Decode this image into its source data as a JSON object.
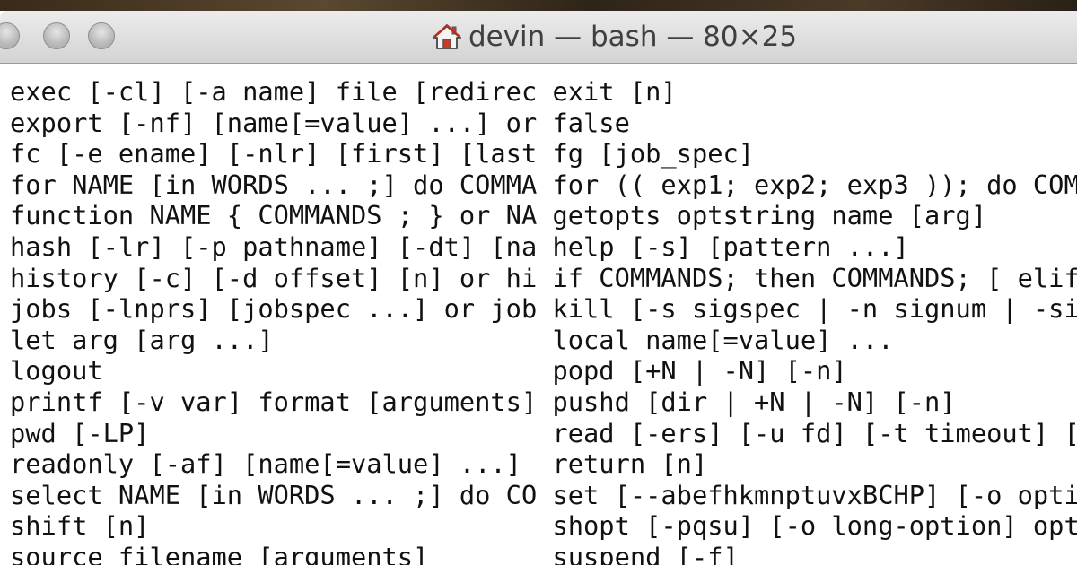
{
  "window": {
    "title": "devin — bash — 80×25"
  },
  "icons": {
    "title_icon": "home-icon",
    "close": "close-button",
    "minimize": "minimize-button",
    "zoom": "zoom-button"
  },
  "colors": {
    "text": "#111111",
    "background": "#ffffff",
    "title_text": "#404040"
  },
  "terminal": {
    "lines": [
      "exec [-cl] [-a name] file [redirec exit [n]",
      "export [-nf] [name[=value] ...] or false",
      "fc [-e ename] [-nlr] [first] [last fg [job_spec]",
      "for NAME [in WORDS ... ;] do COMMA for (( exp1; exp2; exp3 )); do COM",
      "function NAME { COMMANDS ; } or NA getopts optstring name [arg]",
      "hash [-lr] [-p pathname] [-dt] [na help [-s] [pattern ...]",
      "history [-c] [-d offset] [n] or hi if COMMANDS; then COMMANDS; [ elif",
      "jobs [-lnprs] [jobspec ...] or job kill [-s sigspec | -n signum | -si",
      "let arg [arg ...]                  local name[=value] ...",
      "logout                             popd [+N | -N] [-n]",
      "printf [-v var] format [arguments] pushd [dir | +N | -N] [-n]",
      "pwd [-LP]                          read [-ers] [-u fd] [-t timeout] [",
      "readonly [-af] [name[=value] ...]  return [n]",
      "select NAME [in WORDS ... ;] do CO set [--abefhkmnptuvxBCHP] [-o opti",
      "shift [n]                          shopt [-pqsu] [-o long-option] opt",
      "source filename [arguments]        suspend [-f]"
    ]
  }
}
